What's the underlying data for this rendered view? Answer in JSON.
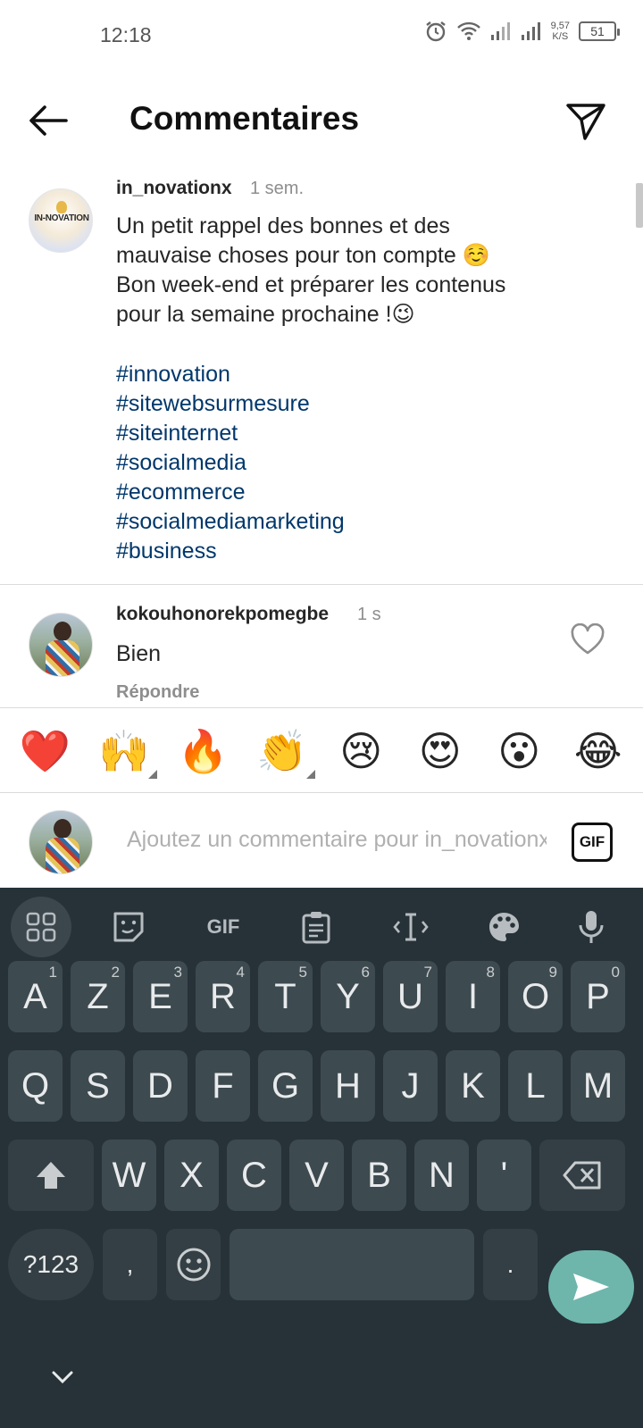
{
  "status_bar": {
    "time": "12:18",
    "speed_value": "9,57",
    "speed_unit": "K/S",
    "battery": "51"
  },
  "header": {
    "title": "Commentaires",
    "back_icon": "arrow-left-icon",
    "send_icon": "paper-plane-icon"
  },
  "caption": {
    "avatar_text": "IN-NOVATION",
    "username": "in_novationx",
    "time": "1 sem.",
    "text": "Un petit rappel des bonnes et des\nmauvaise choses pour ton compte ☺️\nBon week-end et préparer les contenus\npour la semaine prochaine !😉",
    "hashtags": [
      "#innovation",
      "#sitewebsurmesure",
      "#siteinternet",
      "#socialmedia",
      "#ecommerce",
      "#socialmediamarketing",
      "#business"
    ]
  },
  "comment": {
    "username": "kokouhonorekpomegbe",
    "time": "1 s",
    "text": "Bien",
    "reply_label": "Répondre"
  },
  "emoji_bar": [
    "❤️",
    "🙌",
    "🔥",
    "👏",
    "😢",
    "😍",
    "😮",
    "😂"
  ],
  "composer": {
    "placeholder": "Ajoutez un commentaire pour in_novationx",
    "gif_label": "GIF"
  },
  "keyboard": {
    "toolbar": {
      "gif_label": "GIF"
    },
    "row1": [
      {
        "k": "A",
        "h": "1"
      },
      {
        "k": "Z",
        "h": "2"
      },
      {
        "k": "E",
        "h": "3"
      },
      {
        "k": "R",
        "h": "4"
      },
      {
        "k": "T",
        "h": "5"
      },
      {
        "k": "Y",
        "h": "6"
      },
      {
        "k": "U",
        "h": "7"
      },
      {
        "k": "I",
        "h": "8"
      },
      {
        "k": "O",
        "h": "9"
      },
      {
        "k": "P",
        "h": "0"
      }
    ],
    "row2": [
      "Q",
      "S",
      "D",
      "F",
      "G",
      "H",
      "J",
      "K",
      "L",
      "M"
    ],
    "row3": [
      "W",
      "X",
      "C",
      "V",
      "B",
      "N",
      "'"
    ],
    "symbols_label": "?123",
    "comma": ",",
    "period": "."
  },
  "colors": {
    "hashtag": "#00376b",
    "keyboard_bg": "#263238",
    "key_bg": "#3d4a50",
    "enter": "#6eb6ac"
  }
}
